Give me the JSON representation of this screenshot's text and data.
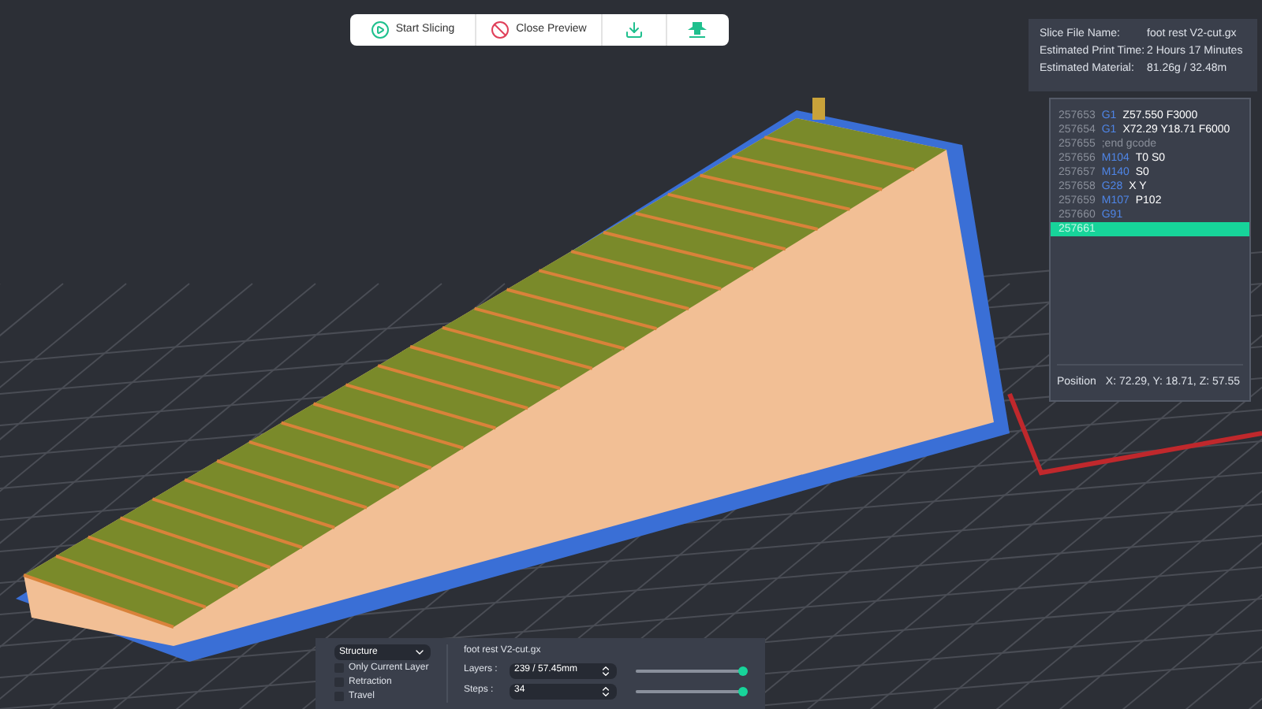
{
  "toolbar": {
    "buttons": [
      {
        "kind": "start",
        "label": "Start Slicing"
      },
      {
        "kind": "close",
        "label": "Close Preview"
      },
      {
        "kind": "export"
      },
      {
        "kind": "print"
      }
    ]
  },
  "slice_info": [
    {
      "label": "Slice File Name:",
      "value": "foot rest V2-cut.gx"
    },
    {
      "label": "Estimated Print Time:",
      "value": "2 Hours 17 Minutes"
    },
    {
      "label": "Estimated Material:",
      "value": "81.26g / 32.48m"
    }
  ],
  "gcode": {
    "lines": [
      {
        "kind": "command",
        "number": "257653",
        "command": "G1",
        "args": "Z57.550 F3000",
        "selected": false
      },
      {
        "kind": "command",
        "number": "257654",
        "command": "G1",
        "args": "X72.29 Y18.71 F6000",
        "selected": false
      },
      {
        "kind": "comment",
        "number": "257655",
        "args": ";end gcode",
        "selected": false
      },
      {
        "kind": "command",
        "number": "257656",
        "command": "M104",
        "args": "T0 S0",
        "selected": false
      },
      {
        "kind": "command",
        "number": "257657",
        "command": "M140",
        "args": "S0",
        "selected": false
      },
      {
        "kind": "command",
        "number": "257658",
        "command": "G28",
        "args": "X Y",
        "selected": false
      },
      {
        "kind": "command",
        "number": "257659",
        "command": "M107",
        "args": "P102",
        "selected": false
      },
      {
        "kind": "command",
        "number": "257660",
        "command": "G91",
        "selected": false
      },
      {
        "kind": "command",
        "number": "257661",
        "selected": true
      }
    ],
    "position_label": "Position",
    "position": "X: 72.29, Y: 18.71, Z: 57.55"
  },
  "preview_panel": {
    "view_select": "Structure",
    "options": [
      {
        "label": "Only Current Layer",
        "checked": false
      },
      {
        "label": "Retraction",
        "checked": false
      },
      {
        "label": "Travel",
        "checked": false
      }
    ],
    "file_name": "foot rest V2-cut.gx",
    "controls": [
      {
        "label": "Layers :",
        "value": "239 / 57.45mm",
        "level": 0.97
      },
      {
        "label": "Steps :",
        "value": "34",
        "level": 0.97
      }
    ]
  }
}
